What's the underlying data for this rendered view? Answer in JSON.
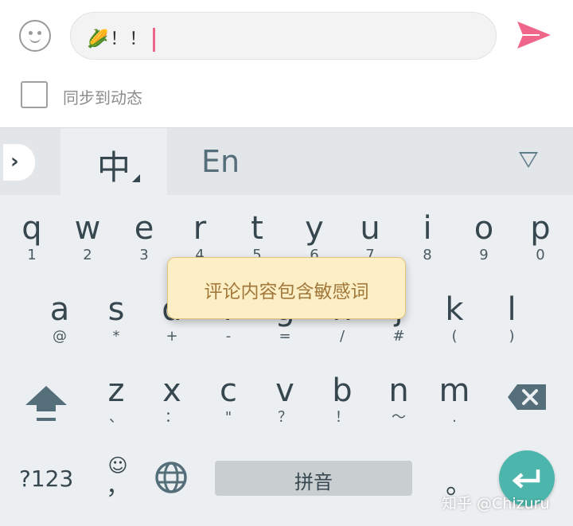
{
  "composer": {
    "input_text": "🌽！！",
    "sync_label": "同步到动态"
  },
  "keyboard": {
    "lang_zh": "中",
    "lang_en": "En",
    "row1": [
      {
        "main": "q",
        "sub": "1"
      },
      {
        "main": "w",
        "sub": "2"
      },
      {
        "main": "e",
        "sub": "3"
      },
      {
        "main": "r",
        "sub": "4"
      },
      {
        "main": "t",
        "sub": "5"
      },
      {
        "main": "y",
        "sub": "6"
      },
      {
        "main": "u",
        "sub": "7"
      },
      {
        "main": "i",
        "sub": "8"
      },
      {
        "main": "o",
        "sub": "9"
      },
      {
        "main": "p",
        "sub": "0"
      }
    ],
    "row2": [
      {
        "main": "a",
        "sub": "@"
      },
      {
        "main": "s",
        "sub": "*"
      },
      {
        "main": "d",
        "sub": "+"
      },
      {
        "main": "f",
        "sub": "-"
      },
      {
        "main": "g",
        "sub": "="
      },
      {
        "main": "h",
        "sub": "/"
      },
      {
        "main": "j",
        "sub": "#"
      },
      {
        "main": "k",
        "sub": "("
      },
      {
        "main": "l",
        "sub": ")"
      }
    ],
    "row3": [
      {
        "main": "z",
        "sub": "、"
      },
      {
        "main": "x",
        "sub": "："
      },
      {
        "main": "c",
        "sub": "\""
      },
      {
        "main": "v",
        "sub": "？"
      },
      {
        "main": "b",
        "sub": "！"
      },
      {
        "main": "n",
        "sub": "～"
      },
      {
        "main": "m",
        "sub": "."
      }
    ],
    "sym_label": "?123",
    "emoji_sub": "，",
    "space_label": "拼音",
    "period_label": "。"
  },
  "toast": {
    "message": "评论内容包含敏感词"
  },
  "watermark": "知乎 @Chizuru",
  "colors": {
    "send_accent": "#f0668a",
    "enter_accent": "#4db6ac",
    "toast_bg": "#fcefc6"
  }
}
